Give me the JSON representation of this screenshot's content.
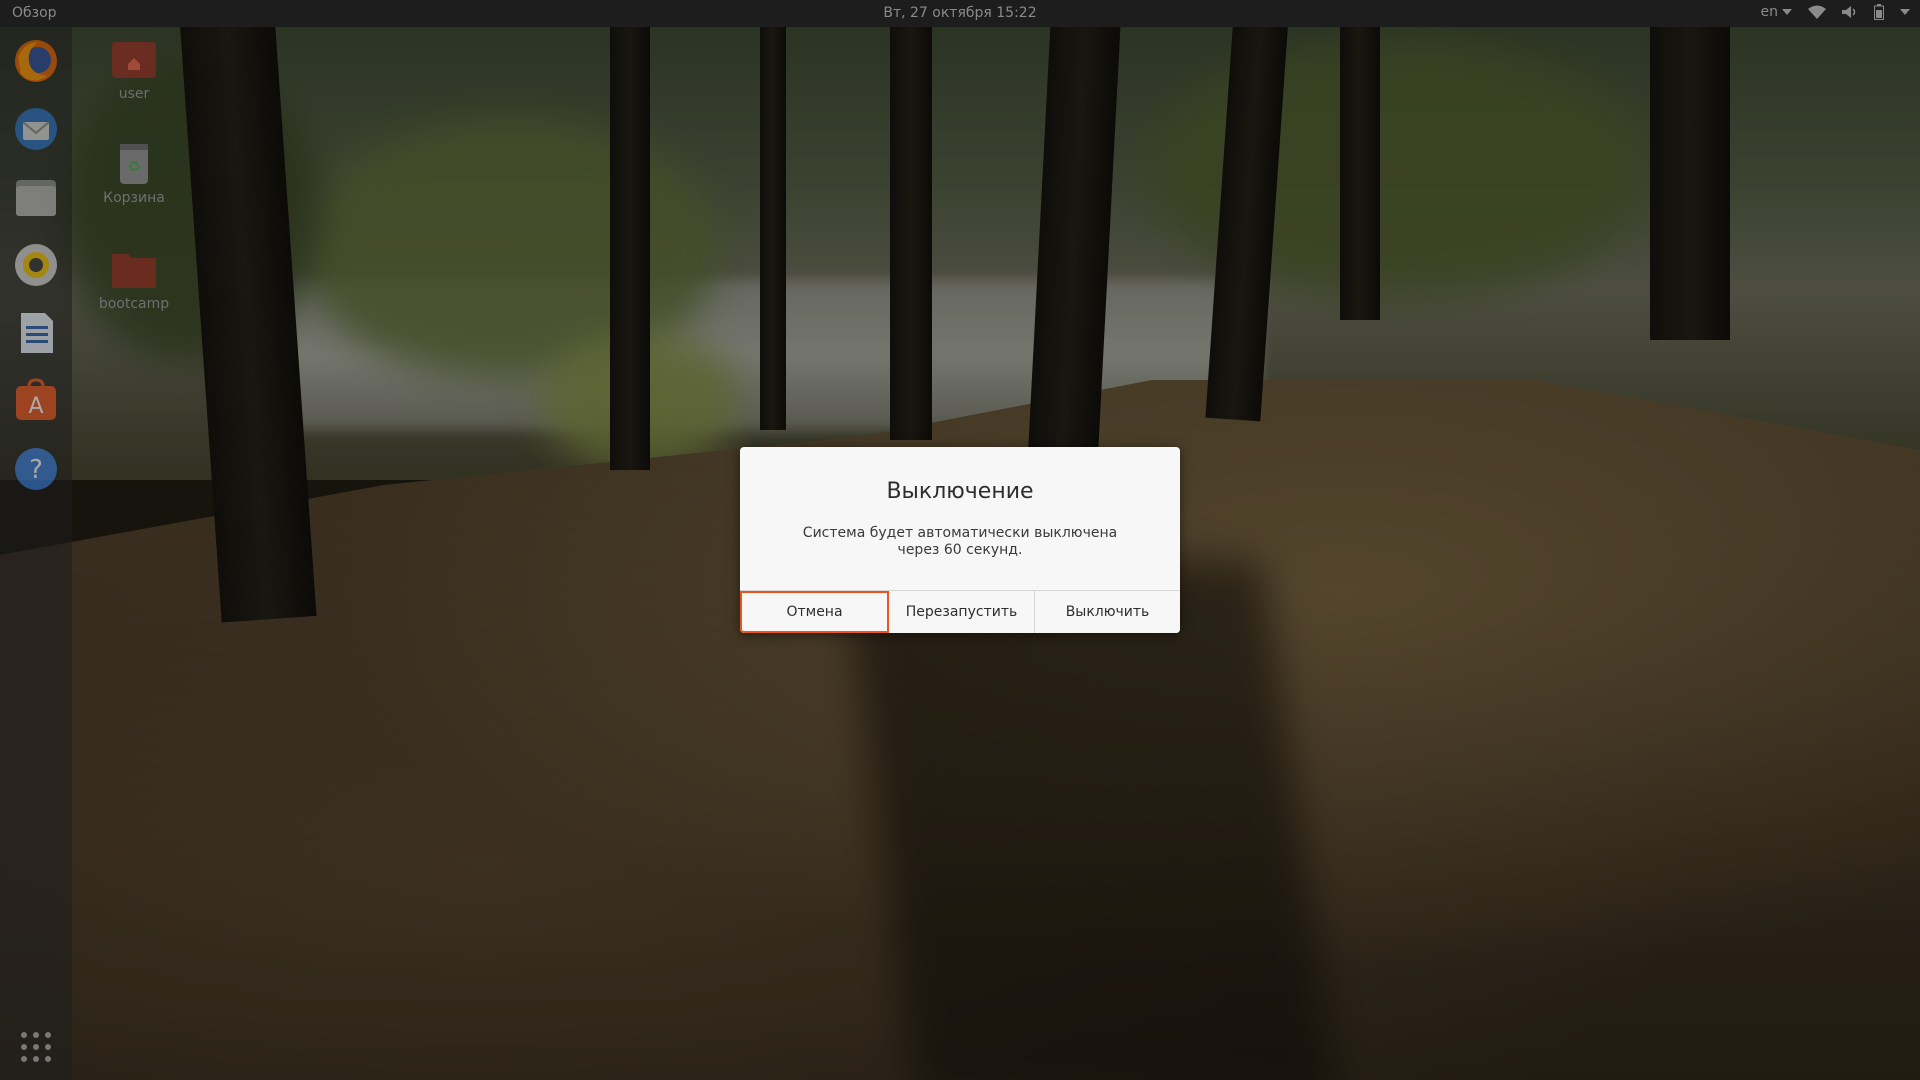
{
  "topbar": {
    "activities": "Обзор",
    "clock": "Вт, 27 октября  15:22",
    "language": "en",
    "tray_icons": [
      "network-wifi-icon",
      "volume-icon",
      "battery-icon",
      "system-menu-chevron-icon"
    ]
  },
  "dock": {
    "items": [
      {
        "name": "firefox-icon"
      },
      {
        "name": "thunderbird-icon"
      },
      {
        "name": "files-icon"
      },
      {
        "name": "rhythmbox-icon"
      },
      {
        "name": "libreoffice-writer-icon"
      },
      {
        "name": "ubuntu-software-icon"
      },
      {
        "name": "help-icon"
      }
    ],
    "show_apps": "show-applications-grid-icon"
  },
  "desktop": {
    "icons": [
      {
        "label": "user",
        "icon": "home-folder-icon"
      },
      {
        "label": "Корзина",
        "icon": "trash-icon"
      },
      {
        "label": "bootcamp",
        "icon": "folder-icon"
      }
    ]
  },
  "dialog": {
    "title": "Выключение",
    "message": "Система будет автоматически выключена через 60 секунд.",
    "buttons": {
      "cancel": "Отмена",
      "restart": "Перезапустить",
      "power_off": "Выключить"
    },
    "focused_button": "cancel",
    "accent_color": "#e95420"
  }
}
